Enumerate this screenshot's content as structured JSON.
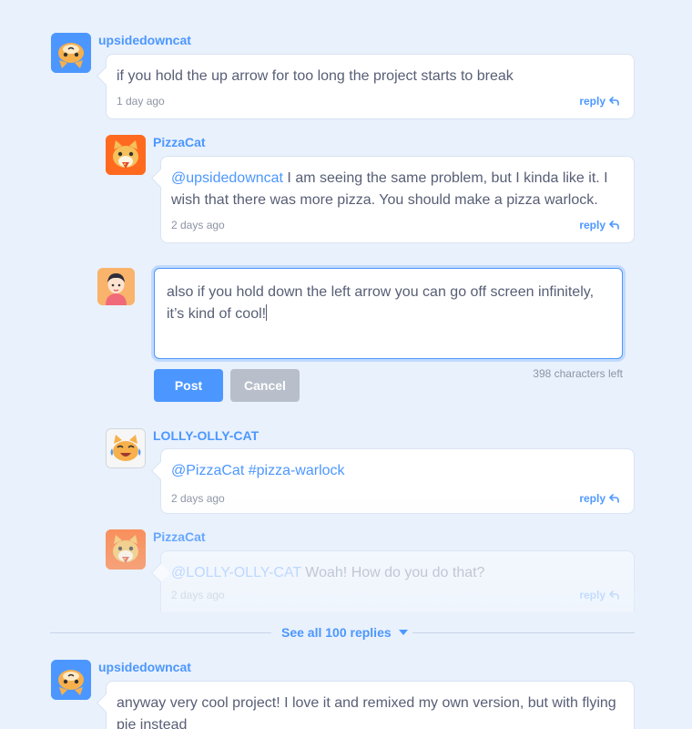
{
  "colors": {
    "background": "#e9f1fc",
    "accent": "#4c97ff",
    "text": "#575e75",
    "muted": "#8d93a3",
    "cancel": "#b8bfca"
  },
  "comments": [
    {
      "username": "upsidedowncat",
      "avatar_icon": "upside-down-cat-avatar-icon",
      "text": "if you hold the up arrow for too long the project starts to break",
      "time": "1 day ago",
      "reply_label": "reply"
    },
    {
      "username": "PizzaCat",
      "avatar_icon": "pizza-cat-avatar-icon",
      "mention": "@upsidedowncat",
      "text": " I am seeing the same problem, but I kinda like it. I wish that there was more pizza. You should make a pizza warlock.",
      "time": "2 days ago",
      "reply_label": "reply"
    },
    {
      "username": "LOLLY-OLLY-CAT",
      "avatar_icon": "crying-laughing-cat-avatar-icon",
      "text": "@PizzaCat #pizza-warlock",
      "time": "2 days ago",
      "reply_label": "reply"
    },
    {
      "username": "PizzaCat",
      "avatar_icon": "pizza-cat-avatar-icon",
      "mention": "@LOLLY-OLLY-CAT",
      "text": " Woah! How do you do that?",
      "time": "2 days ago",
      "reply_label": "reply"
    },
    {
      "username": "upsidedowncat",
      "avatar_icon": "upside-down-cat-avatar-icon",
      "text": "anyway very cool project! I love it and remixed my own version, but with flying pie instead"
    }
  ],
  "compose": {
    "avatar_icon": "user-avatar-icon",
    "value": "also if you hold down the left arrow you can go off screen infinitely, it’s kind of cool!",
    "chars_left": "398 characters left",
    "post_label": "Post",
    "cancel_label": "Cancel"
  },
  "see_all": {
    "label": "See all 100 replies"
  }
}
